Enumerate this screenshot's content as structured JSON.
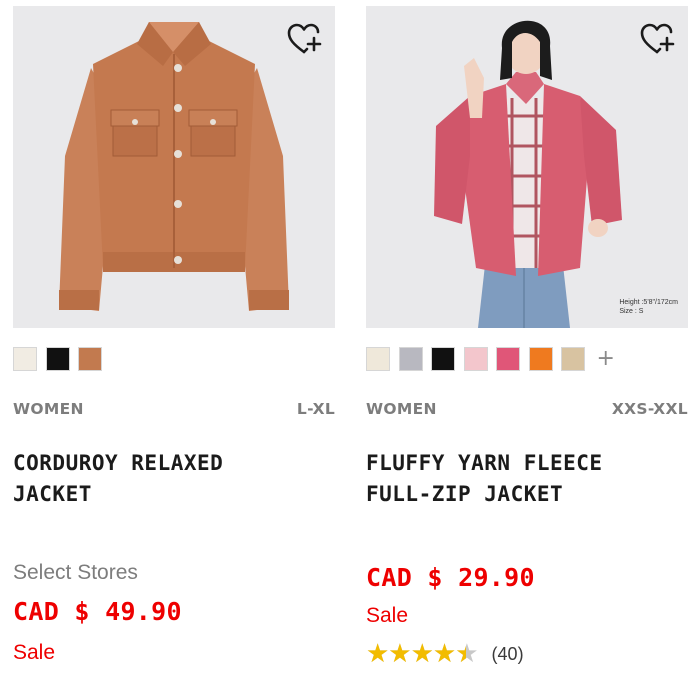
{
  "products": [
    {
      "gender": "WOMEN",
      "sizes": "L-XL",
      "name_line1": "CORDUROY RELAXED",
      "name_line2": "JACKET",
      "availability": "Select Stores",
      "price": "CAD $ 49.90",
      "sale_label": "Sale",
      "wishlist_icon": "heart-plus-icon",
      "swatches": [
        "#f1ece3",
        "#111111",
        "#c27a4f"
      ]
    },
    {
      "gender": "WOMEN",
      "sizes": "XXS-XXL",
      "name_line1": "FLUFFY YARN FLEECE",
      "name_line2": "FULL-ZIP JACKET",
      "price": "CAD $ 29.90",
      "sale_label": "Sale",
      "wishlist_icon": "heart-plus-icon",
      "model_height": "Height :5'8\"/172cm",
      "model_size": "Size : S",
      "swatches": [
        "#efe8da",
        "#b8b8c0",
        "#111111",
        "#f3c6cc",
        "#e05678",
        "#ef7a1f",
        "#d8c3a1"
      ],
      "more_swatches": "+",
      "rating": 4.5,
      "review_count": "(40)"
    }
  ],
  "colors": {
    "price_red": "#ee0000",
    "star_gold": "#f2bc00",
    "meta_gray": "#7d7d7d"
  }
}
